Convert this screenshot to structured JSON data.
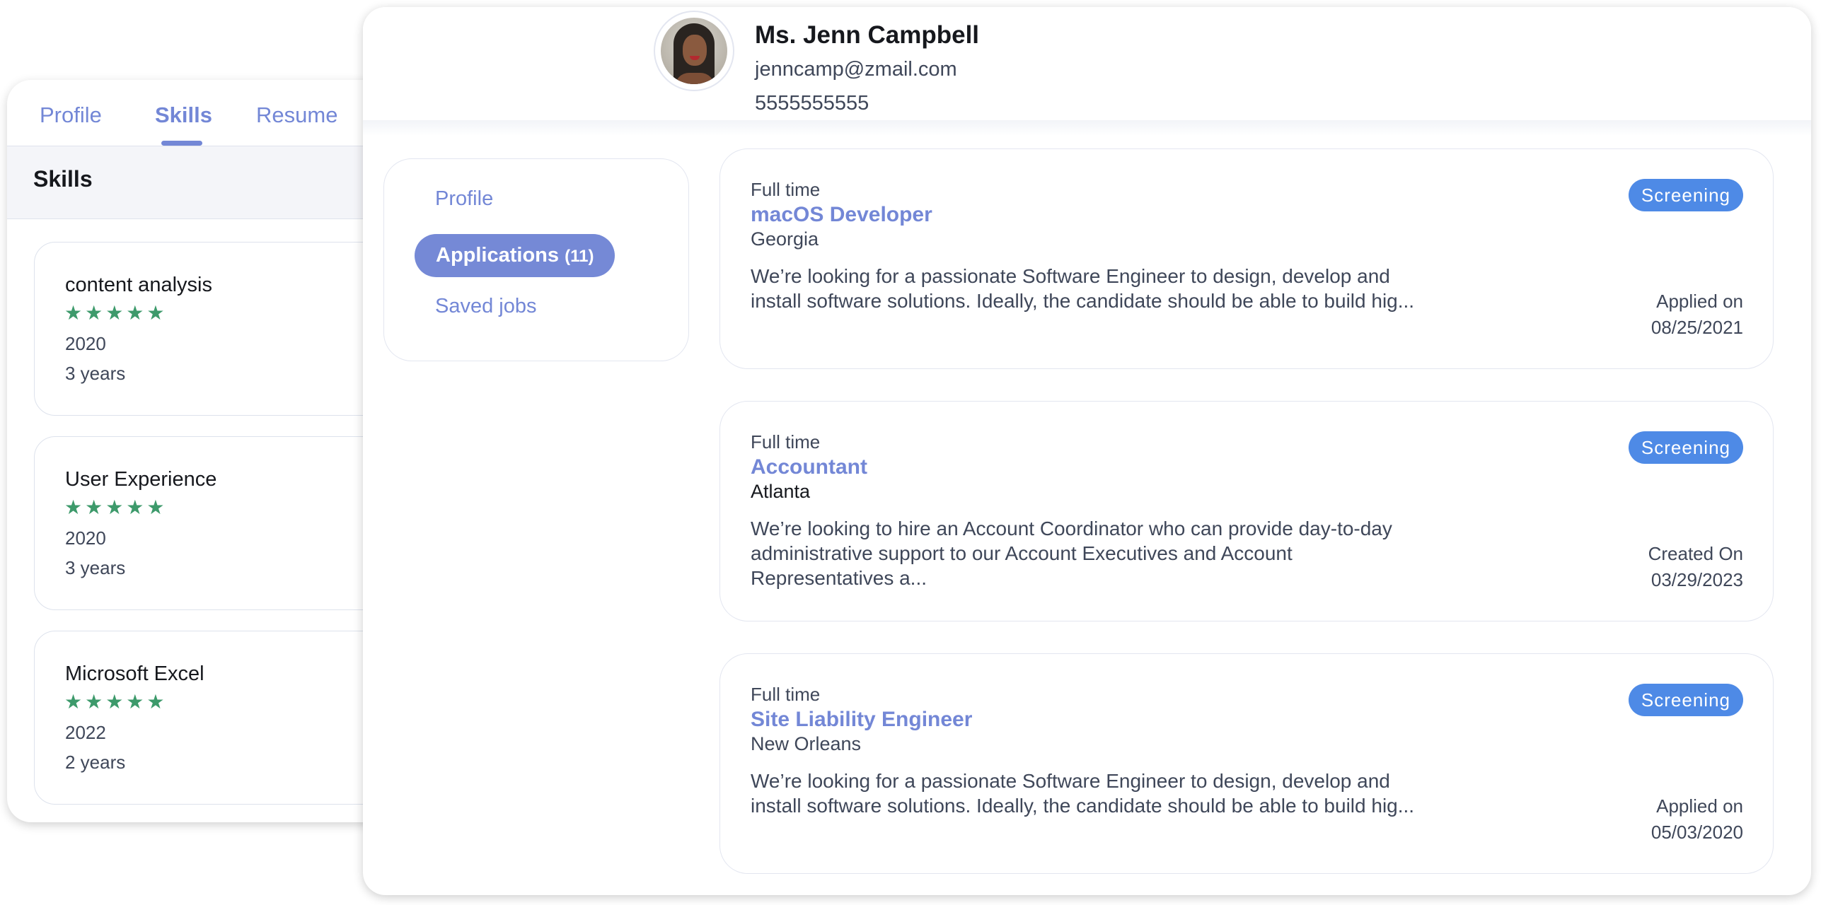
{
  "skills_panel": {
    "tabs": [
      {
        "label": "Profile",
        "active": false
      },
      {
        "label": "Skills",
        "active": true
      },
      {
        "label": "Resume",
        "active": false
      }
    ],
    "header": "Skills",
    "skills": [
      {
        "name": "content analysis",
        "rating": 5,
        "rating_max": 5,
        "stars": "★★★★★",
        "year": "2020",
        "duration": "3 years"
      },
      {
        "name": "User Experience",
        "rating": 5,
        "rating_max": 5,
        "stars": "★★★★★",
        "year": "2020",
        "duration": "3 years"
      },
      {
        "name": "Microsoft Excel",
        "rating": 5,
        "rating_max": 5,
        "stars": "★★★★★",
        "year": "2022",
        "duration": "2 years"
      }
    ]
  },
  "profile": {
    "name": "Ms. Jenn Campbell",
    "email": "jenncamp@zmail.com",
    "phone": "5555555555",
    "avatar": "user-photo"
  },
  "side_nav": {
    "items": [
      {
        "label": "Profile",
        "active": false
      },
      {
        "label": "Applications",
        "count": "(11)",
        "active": true
      },
      {
        "label": "Saved jobs",
        "active": false
      }
    ]
  },
  "applications": [
    {
      "type": "Full time",
      "title": "macOS Developer",
      "location": "Georgia",
      "description": "We’re looking for a passionate Software Engineer to design, develop and install software solutions. Ideally, the candidate should be able to build hig...",
      "status": "Screening",
      "date_label": "Applied on",
      "date": "08/25/2021"
    },
    {
      "type": "Full time",
      "title": "Accountant",
      "location": "Atlanta",
      "description": "We’re looking to hire an Account Coordinator who can provide day-to-day administrative support to our Account Executives and Account Representatives a...",
      "status": "Screening",
      "date_label": "Created On",
      "date": "03/29/2023"
    },
    {
      "type": "Full time",
      "title": "Site Liability Engineer",
      "location": "New Orleans",
      "description": "We’re looking for a passionate Software Engineer to design, develop and install software solutions. Ideally, the candidate should be able to build hig...",
      "status": "Screening",
      "date_label": "Applied on",
      "date": "05/03/2020"
    }
  ],
  "colors": {
    "accent": "#7387d6",
    "status_badge": "#4e8ae6",
    "star": "#3d9a6b",
    "text_dark": "#16181d",
    "text_muted": "#3f4759"
  }
}
